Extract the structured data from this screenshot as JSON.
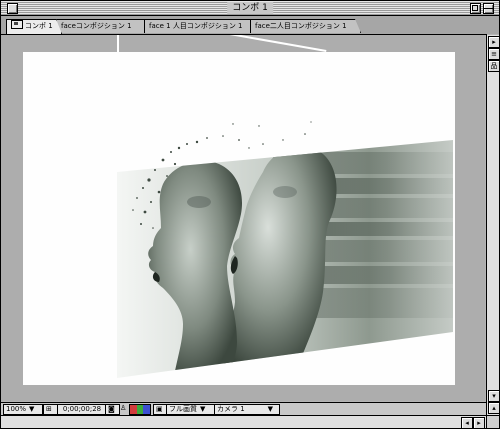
{
  "window": {
    "title": "コンポ 1"
  },
  "tabs": [
    {
      "label": "コンポ 1",
      "active": true
    },
    {
      "label": "faceコンポジション 1",
      "active": false
    },
    {
      "label": "face 1 人目コンポジション 1",
      "active": false
    },
    {
      "label": "face二人目コンポジション 1",
      "active": false
    }
  ],
  "controls": {
    "zoom": "100%",
    "timecode": "0;00;00;28",
    "resolution": "フル画質",
    "camera": "カメラ 1"
  },
  "icons": {
    "close": "close-box-icon",
    "zoom": "zoom-box-icon",
    "collapse": "windowshade-icon",
    "tab": "composition-icon",
    "snapshot": "camera-snapshot-icon",
    "show_snapshot": "show-snapshot-icon",
    "channels": "rgb-channels-icon",
    "region": "region-of-interest-icon",
    "safe_zones": "title-safe-icon"
  },
  "colors": {
    "channel_red": "#d23c3c",
    "channel_green": "#3caa3c",
    "channel_blue": "#3c50d2"
  }
}
